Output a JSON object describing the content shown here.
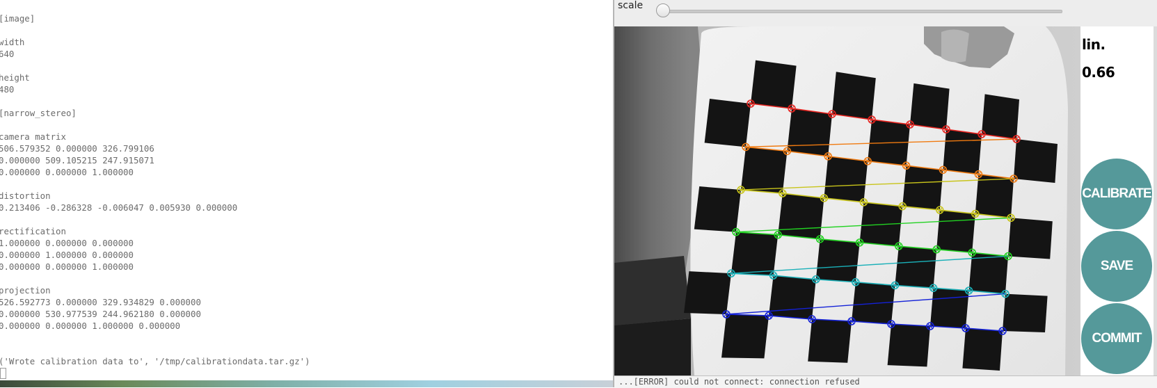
{
  "terminal": {
    "lines": [
      "[image]",
      "",
      "width",
      "640",
      "",
      "height",
      "480",
      "",
      "[narrow_stereo]",
      "",
      "camera matrix",
      "506.579352 0.000000 326.799106",
      "0.000000 509.105215 247.915071",
      "0.000000 0.000000 1.000000",
      "",
      "distortion",
      "0.213406 -0.286328 -0.006047 0.005930 0.000000",
      "",
      "rectification",
      "1.000000 0.000000 0.000000",
      "0.000000 1.000000 0.000000",
      "0.000000 0.000000 1.000000",
      "",
      "projection",
      "526.592773 0.000000 329.934829 0.000000",
      "0.000000 530.977539 244.962180 0.000000",
      "0.000000 0.000000 1.000000 0.000000",
      "",
      "",
      "('Wrote calibration data to', '/tmp/calibrationdata.tar.gz')"
    ]
  },
  "calibration_window": {
    "scale_label": "scale",
    "scale_value": 0,
    "lin_label": "lin.",
    "lin_value": "0.66",
    "calibrate_label": "CALIBRATE",
    "save_label": "SAVE",
    "commit_label": "COMMIT",
    "button_color": "#55999a",
    "status_text": "...[ERROR] could not connect: connection refused",
    "row_colors": [
      "#e8231e",
      "#f07a10",
      "#c8c41a",
      "#22d222",
      "#1ab0b8",
      "#1422d8"
    ]
  }
}
